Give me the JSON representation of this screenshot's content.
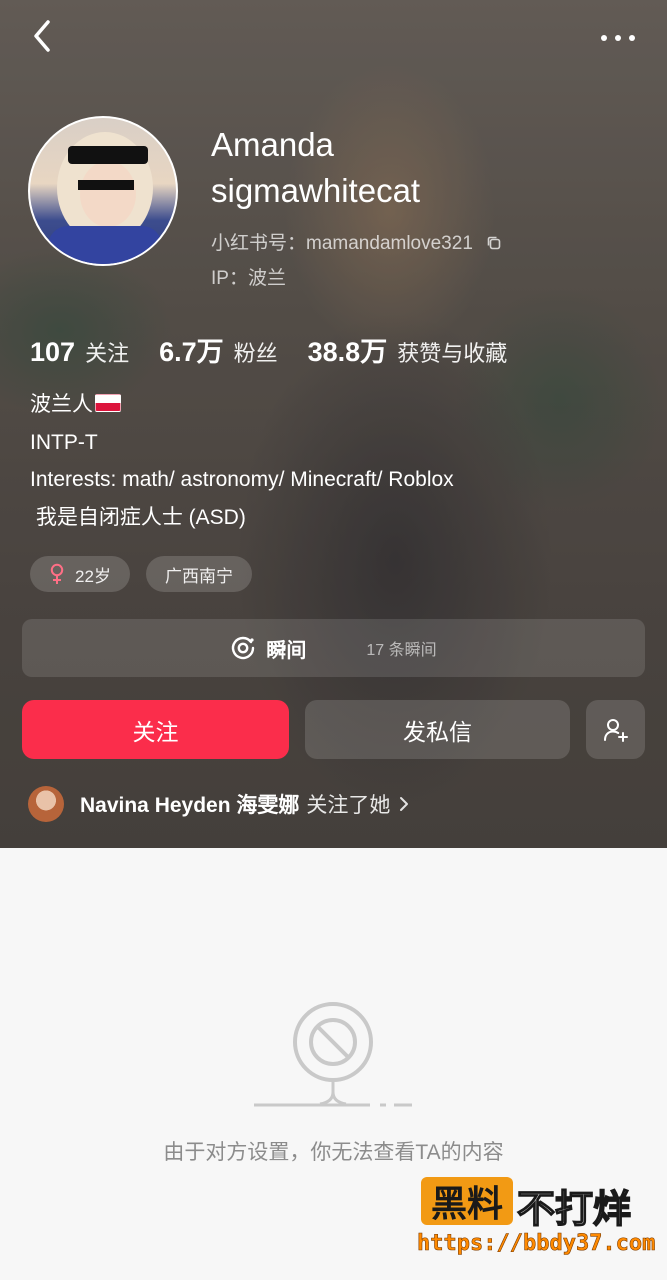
{
  "header": {
    "back_icon": "chevron-left-icon",
    "more_icon": "more-horizontal-icon"
  },
  "profile": {
    "name_line1": "Amanda",
    "name_line2": "sigmawhitecat",
    "xhs_id_label": "小红书号：",
    "xhs_id_value": "mamandamlove321",
    "ip_label": "IP：",
    "ip_value": "波兰"
  },
  "stats": [
    {
      "value": "107",
      "label": "关注"
    },
    {
      "value": "6.7万",
      "label": "粉丝"
    },
    {
      "value": "38.8万",
      "label": "获赞与收藏"
    }
  ],
  "bio": [
    "波兰人",
    "INTP-T",
    "Interests: math/ astronomy/ Minecraft/ Roblox",
    " 我是自闭症人士 (ASD)"
  ],
  "tags": {
    "age": "22岁",
    "gender_icon": "female-icon",
    "location": "广西南宁"
  },
  "moments": {
    "title": "瞬间",
    "count": "17 条瞬间"
  },
  "actions": {
    "follow": "关注",
    "message": "发私信"
  },
  "recommendation": {
    "name": "Navina Heyden 海雯娜",
    "text": "关注了她"
  },
  "empty_state": {
    "text": "由于对方设置，你无法查看TA的内容"
  },
  "watermark": {
    "box": "黑料",
    "text": "不打烊",
    "url": "https://bbdy37.com"
  },
  "colors": {
    "accent": "#fb2d4b",
    "watermark_orange": "#f29a14"
  }
}
